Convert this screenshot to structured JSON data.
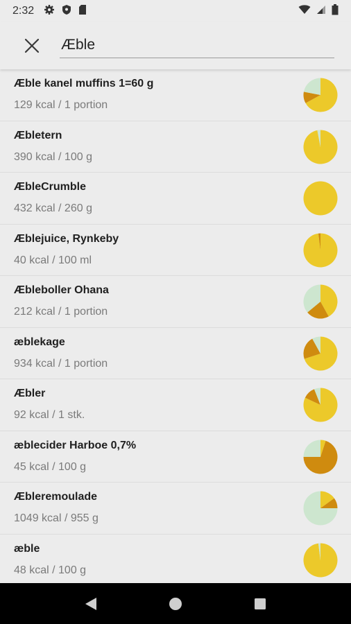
{
  "status": {
    "time": "2:32",
    "left_icons": [
      "settings-icon",
      "shield-icon",
      "sd-card-icon"
    ],
    "right_icons": [
      "wifi-icon",
      "signal-icon",
      "battery-icon"
    ]
  },
  "search": {
    "value": "Æble",
    "close_icon": "close-icon"
  },
  "colors": {
    "carbs": "#ecc92a",
    "fat": "#cf8b0f",
    "protein": "#cde6cf"
  },
  "items": [
    {
      "name": "Æble kanel muffins 1=60 g",
      "sub": "129 kcal / 1 portion",
      "pie": {
        "carbs": 0.67,
        "fat": 0.11,
        "protein": 0.22
      }
    },
    {
      "name": "Æbletern",
      "sub": "390 kcal / 100 g",
      "pie": {
        "carbs": 0.97,
        "fat": 0.0,
        "protein": 0.03
      }
    },
    {
      "name": "ÆbleCrumble",
      "sub": "432 kcal / 260 g",
      "pie": {
        "carbs": 1.0,
        "fat": 0.0,
        "protein": 0.0
      }
    },
    {
      "name": "Æblejuice, Rynkeby",
      "sub": "40 kcal / 100 ml",
      "pie": {
        "carbs": 0.98,
        "fat": 0.02,
        "protein": 0.0
      }
    },
    {
      "name": "Æbleboller Ohana",
      "sub": "212 kcal / 1 portion",
      "pie": {
        "carbs": 0.42,
        "fat": 0.22,
        "protein": 0.36
      }
    },
    {
      "name": "æblekage",
      "sub": "934 kcal / 1 portion",
      "pie": {
        "carbs": 0.7,
        "fat": 0.22,
        "protein": 0.08
      }
    },
    {
      "name": "Æbler",
      "sub": "92 kcal / 1 stk.",
      "pie": {
        "carbs": 0.82,
        "fat": 0.12,
        "protein": 0.06
      }
    },
    {
      "name": "æblecider Harboe 0,7%",
      "sub": "45 kcal / 100 g",
      "pie": {
        "carbs": 0.05,
        "fat": 0.7,
        "protein": 0.25
      }
    },
    {
      "name": "Æbleremoulade",
      "sub": "1049 kcal / 955 g",
      "pie": {
        "carbs": 0.15,
        "fat": 0.1,
        "protein": 0.75
      }
    },
    {
      "name": "æble",
      "sub": "48 kcal / 100 g",
      "pie": {
        "carbs": 0.98,
        "fat": 0.0,
        "protein": 0.02
      }
    }
  ],
  "nav": [
    "back-icon",
    "home-icon",
    "recents-icon"
  ]
}
